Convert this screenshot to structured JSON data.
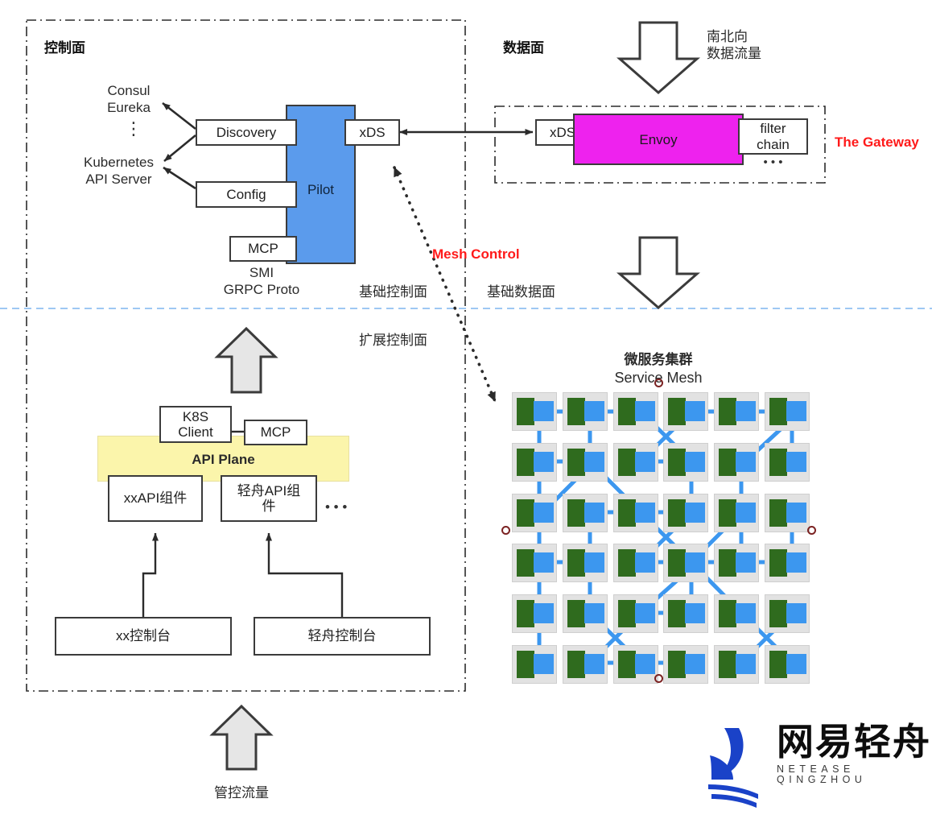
{
  "diagram": {
    "title_control_plane": "控制面",
    "title_data_plane": "数据面"
  },
  "control_plane": {
    "registries": "Consul\nEureka",
    "registries_ellipsis": "⋮",
    "k8s": "Kubernetes\nAPI Server",
    "discovery": "Discovery",
    "config": "Config",
    "mcp": "MCP",
    "pilot": "Pilot",
    "xds": "xDS",
    "smi_note": "SMI\nGRPC Proto",
    "base_control_plane": "基础控制面",
    "extended_control_plane": "扩展控制面"
  },
  "data_plane": {
    "north_south_traffic": "南北向\n数据流量",
    "xds": "xDS",
    "envoy": "Envoy",
    "filter_chain": "filter\nchain",
    "filter_ellipsis": "• • •",
    "gateway_label": "The Gateway",
    "base_data_plane": "基础数据面"
  },
  "mesh_control": {
    "label": "Mesh Control"
  },
  "api_plane": {
    "k8s_client": "K8S\nClient",
    "mcp": "MCP",
    "title": "API Plane",
    "component_xx": "xxAPI组件",
    "component_qingzhou": "轻舟API组\n件",
    "components_ellipsis": "• • •",
    "console_xx": "xx控制台",
    "console_qingzhou": "轻舟控制台"
  },
  "service_mesh": {
    "title_cn": "微服务集群",
    "title_en": "Service Mesh"
  },
  "bottom": {
    "control_traffic": "管控流量"
  },
  "logo": {
    "cn": "网易轻舟",
    "en": "NETEASE QINGZHOU"
  },
  "colors": {
    "pilot": "#5b9bec",
    "envoy": "#ee22ee",
    "api_plane": "#fbf5ab",
    "mesh_node_green": "#2f6b1e",
    "mesh_node_blue": "#3c97ef",
    "mesh_node_bg": "#e2e2e2",
    "accent_red": "#ff1a1a",
    "divider_blue": "#7fb5ef",
    "logo_blue": "#1a42c8"
  }
}
